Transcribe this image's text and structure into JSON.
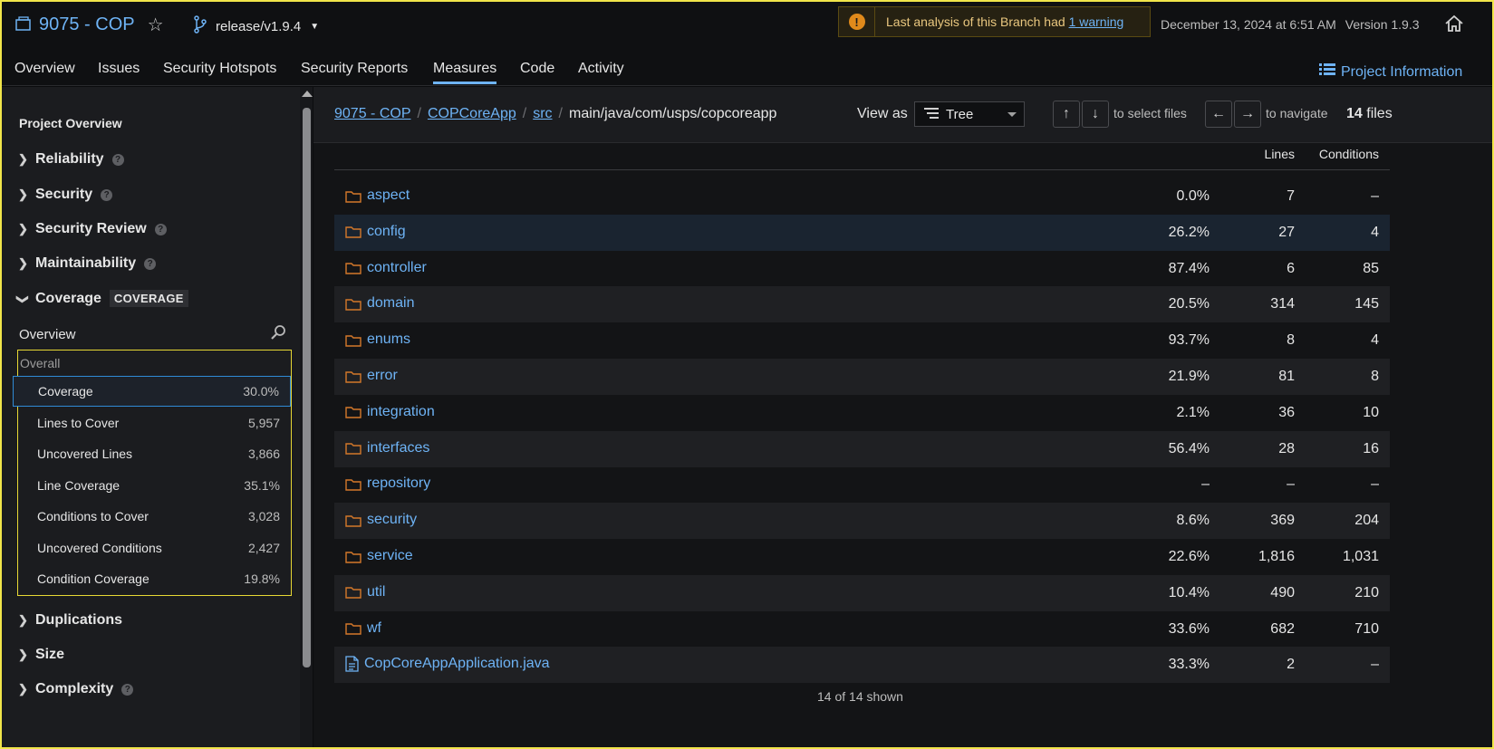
{
  "header": {
    "project_name": "9075 - COP",
    "branch": "release/v1.9.4",
    "warning_text": "Last analysis of this Branch had",
    "warning_link": "1 warning",
    "analysis_date": "December 13, 2024 at 6:51 AM",
    "version": "Version 1.9.3"
  },
  "nav": {
    "tabs": [
      "Overview",
      "Issues",
      "Security Hotspots",
      "Security Reports",
      "Measures",
      "Code",
      "Activity"
    ],
    "active": "Measures",
    "project_info": "Project Information"
  },
  "sidebar": {
    "title": "Project Overview",
    "sections": [
      {
        "label": "Reliability",
        "help": true
      },
      {
        "label": "Security",
        "help": true
      },
      {
        "label": "Security Review",
        "help": true
      },
      {
        "label": "Maintainability",
        "help": true
      },
      {
        "label": "Coverage",
        "tag": "COVERAGE",
        "expanded": true
      },
      {
        "label": "Duplications",
        "help": false
      },
      {
        "label": "Size",
        "help": false
      },
      {
        "label": "Complexity",
        "help": true
      }
    ],
    "overview_label": "Overview",
    "overall_label": "Overall",
    "metrics": [
      {
        "label": "Coverage",
        "value": "30.0%"
      },
      {
        "label": "Lines to Cover",
        "value": "5,957"
      },
      {
        "label": "Uncovered Lines",
        "value": "3,866"
      },
      {
        "label": "Line Coverage",
        "value": "35.1%"
      },
      {
        "label": "Conditions to Cover",
        "value": "3,028"
      },
      {
        "label": "Uncovered Conditions",
        "value": "2,427"
      },
      {
        "label": "Condition Coverage",
        "value": "19.8%"
      }
    ]
  },
  "main": {
    "breadcrumbs": [
      "9075 - COP",
      "COPCoreApp",
      "src"
    ],
    "current_path": "main/java/com/usps/copcoreapp",
    "view_as_label": "View as",
    "view_mode": "Tree",
    "select_hint": "to select files",
    "navigate_hint": "to navigate",
    "files_count": "14",
    "files_label": "files",
    "columns": [
      "Lines",
      "Conditions"
    ],
    "rows": [
      {
        "name": "aspect",
        "type": "folder",
        "coverage": "0.0%",
        "lines": "7",
        "conditions": "–"
      },
      {
        "name": "config",
        "type": "folder",
        "coverage": "26.2%",
        "lines": "27",
        "conditions": "4"
      },
      {
        "name": "controller",
        "type": "folder",
        "coverage": "87.4%",
        "lines": "6",
        "conditions": "85"
      },
      {
        "name": "domain",
        "type": "folder",
        "coverage": "20.5%",
        "lines": "314",
        "conditions": "145"
      },
      {
        "name": "enums",
        "type": "folder",
        "coverage": "93.7%",
        "lines": "8",
        "conditions": "4"
      },
      {
        "name": "error",
        "type": "folder",
        "coverage": "21.9%",
        "lines": "81",
        "conditions": "8"
      },
      {
        "name": "integration",
        "type": "folder",
        "coverage": "2.1%",
        "lines": "36",
        "conditions": "10"
      },
      {
        "name": "interfaces",
        "type": "folder",
        "coverage": "56.4%",
        "lines": "28",
        "conditions": "16"
      },
      {
        "name": "repository",
        "type": "folder",
        "coverage": "–",
        "lines": "–",
        "conditions": "–"
      },
      {
        "name": "security",
        "type": "folder",
        "coverage": "8.6%",
        "lines": "369",
        "conditions": "204"
      },
      {
        "name": "service",
        "type": "folder",
        "coverage": "22.6%",
        "lines": "1,816",
        "conditions": "1,031"
      },
      {
        "name": "util",
        "type": "folder",
        "coverage": "10.4%",
        "lines": "490",
        "conditions": "210"
      },
      {
        "name": "wf",
        "type": "folder",
        "coverage": "33.6%",
        "lines": "682",
        "conditions": "710"
      },
      {
        "name": "CopCoreAppApplication.java",
        "type": "file",
        "coverage": "33.3%",
        "lines": "2",
        "conditions": "–"
      }
    ],
    "shown_text": "14 of 14 shown"
  },
  "colors": {
    "accent": "#6eb3f5",
    "folder": "#d4782a",
    "highlight": "#f1e54a"
  }
}
